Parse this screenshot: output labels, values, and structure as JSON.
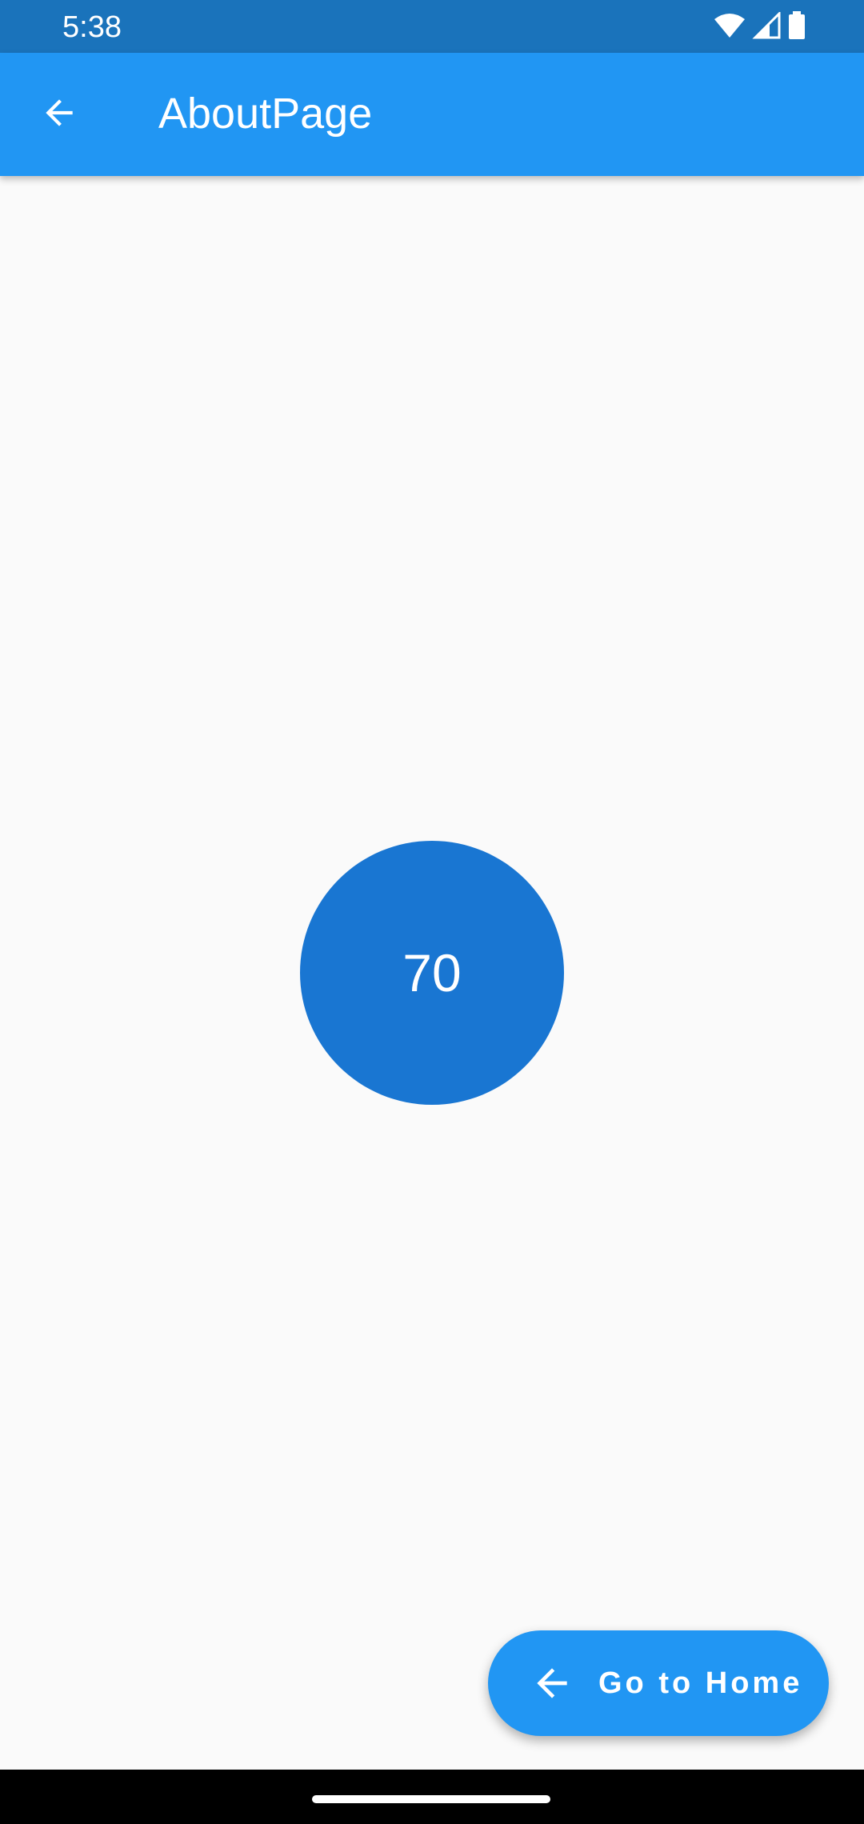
{
  "status_bar": {
    "time": "5:38",
    "icons": [
      "wifi-icon",
      "signal-icon",
      "battery-icon"
    ]
  },
  "app_bar": {
    "back_icon": "arrow-back-icon",
    "title": "AboutPage"
  },
  "counter": {
    "value": "70"
  },
  "fab": {
    "icon": "arrow-back-icon",
    "label": "Go to Home"
  },
  "colors": {
    "status_bar": "#1a73bb",
    "app_bar": "#2196f3",
    "circle": "#1976d2",
    "fab": "#2196f3",
    "background": "#fafafa"
  }
}
